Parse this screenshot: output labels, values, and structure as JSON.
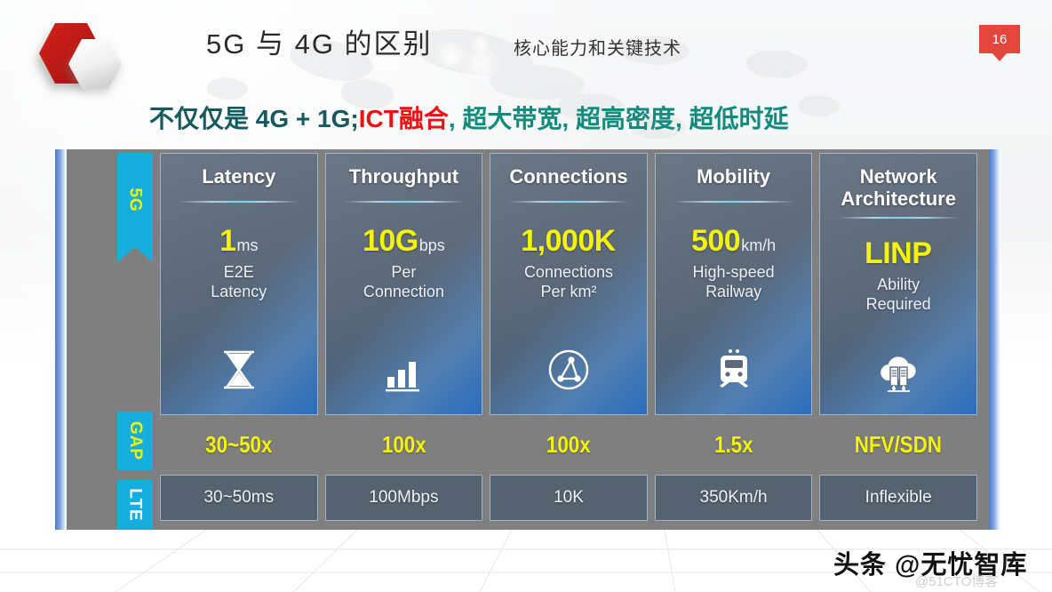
{
  "header": {
    "title": "5G 与 4G 的区别",
    "subtitle": "核心能力和关键技术",
    "page_number": "16",
    "logo_icon": "hexagon-logo-icon"
  },
  "headline": {
    "seg_dark": "不仅仅是 4G + 1G;",
    "seg_red": "ICT融合",
    "seg_teal": ", 超大带宽, 超高密度, 超低时延"
  },
  "ribbons": [
    {
      "label": "5G",
      "color": "#15aedd",
      "text_color": "#f2f207"
    },
    {
      "label": "GAP",
      "color": "#15aedd",
      "text_color": "#f2f207"
    },
    {
      "label": "LTE",
      "color": "#15aedd",
      "text_color": "#ffffff"
    }
  ],
  "cards": [
    {
      "title": "Latency",
      "metric_value": "1",
      "metric_unit": "ms",
      "desc_line1": "E2E",
      "desc_line2": "Latency",
      "icon": "hourglass-icon"
    },
    {
      "title": "Throughput",
      "metric_value": "10G",
      "metric_unit": "bps",
      "desc_line1": "Per",
      "desc_line2": "Connection",
      "icon": "bar-chart-icon"
    },
    {
      "title": "Connections",
      "metric_value": "1,000K",
      "metric_unit": "",
      "desc_line1": "Connections",
      "desc_line2": "Per km²",
      "icon": "network-nodes-icon"
    },
    {
      "title": "Mobility",
      "metric_value": "500",
      "metric_unit": "km/h",
      "desc_line1": "High-speed",
      "desc_line2": "Railway",
      "icon": "train-icon"
    },
    {
      "title_line1": "Network",
      "title_line2": "Architecture",
      "metric_value": "LINP",
      "metric_unit": "",
      "desc_line1": "Ability",
      "desc_line2": "Required",
      "icon": "cloud-servers-icon"
    }
  ],
  "gap_row": {
    "values": [
      "30~50x",
      "100x",
      "100x",
      "1.5x",
      "NFV/SDN"
    ]
  },
  "lte_row": {
    "values": [
      "30~50ms",
      "100Mbps",
      "10K",
      "350Km/h",
      "Inflexible"
    ]
  },
  "watermarks": {
    "primary": "头条 @无忧智库",
    "secondary": "@51CTO博客"
  },
  "colors": {
    "accent_cyan": "#15aedd",
    "metric_yellow": "#f4f40a",
    "badge_red": "#e2463c",
    "headline_red": "#ee1111",
    "headline_teal": "#128b7d",
    "panel_grey": "#7f7f7f"
  }
}
